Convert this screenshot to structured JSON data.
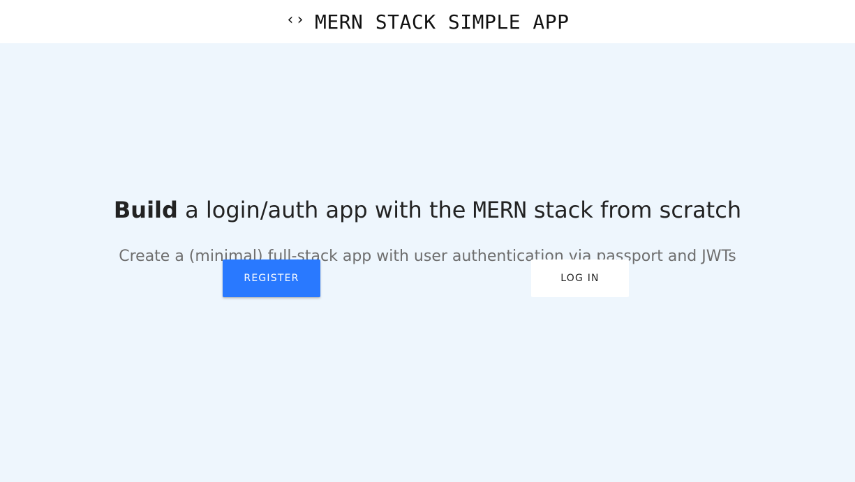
{
  "navbar": {
    "brand_icon": "‹›",
    "brand_text": "MERN STACK SIMPLE APP"
  },
  "hero": {
    "title_bold": "Build",
    "title_part1": " a login/auth app with the ",
    "title_mono": "MERN",
    "title_part2": " stack from scratch",
    "subtitle": "Create a (minimal) full-stack app with user authentication via passport and JWTs"
  },
  "actions": {
    "register_label": "REGISTER",
    "login_label": "LOG IN"
  },
  "colors": {
    "primary": "#2979ff",
    "background": "#eef6fd"
  }
}
